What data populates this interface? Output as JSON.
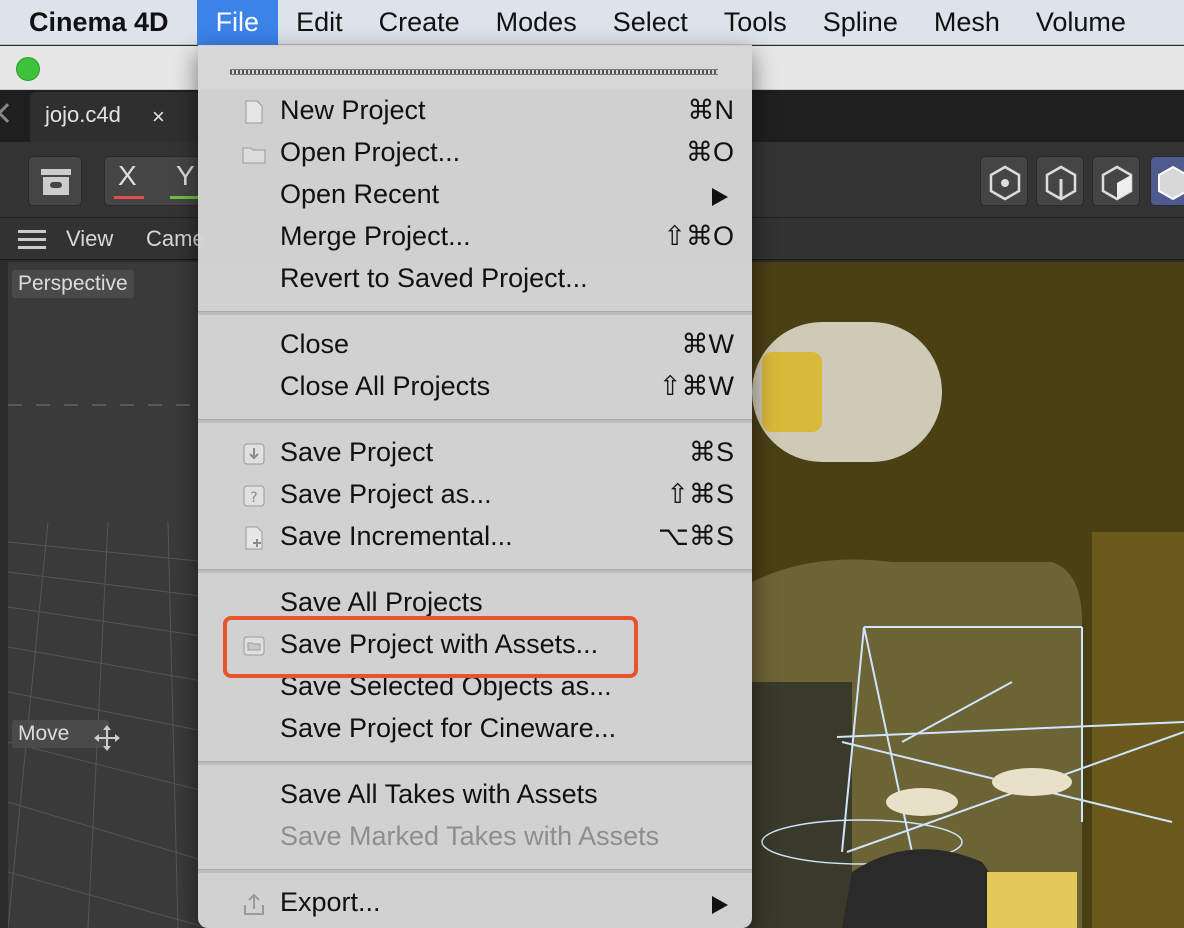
{
  "menubar": {
    "app_name": "Cinema 4D",
    "items": [
      "File",
      "Edit",
      "Create",
      "Modes",
      "Select",
      "Tools",
      "Spline",
      "Mesh",
      "Volume"
    ]
  },
  "tab": {
    "title": "jojo.c4d",
    "close": "×"
  },
  "toolbar": {
    "axis_x": "X",
    "axis_y": "Y",
    "axis_x_color": "#e05050",
    "axis_y_color": "#6cc04a"
  },
  "viewport": {
    "menu_view": "View",
    "menu_camera": "Came",
    "perspective": "Perspective",
    "move": "Move",
    "move_icon": "move-arrows-icon"
  },
  "file_menu": {
    "items": [
      {
        "label": "New Project",
        "shortcut": "⌘N",
        "icon": "document-icon"
      },
      {
        "label": "Open Project...",
        "shortcut": "⌘O",
        "icon": "folder-icon"
      },
      {
        "label": "Open Recent",
        "shortcut": "",
        "submenu": true
      },
      {
        "label": "Merge Project...",
        "shortcut": "⇧⌘O"
      },
      {
        "label": "Revert to Saved Project...",
        "shortcut": ""
      },
      {
        "label": "Close",
        "shortcut": "⌘W"
      },
      {
        "label": "Close All Projects",
        "shortcut": "⇧⌘W"
      },
      {
        "label": "Save Project",
        "shortcut": "⌘S",
        "icon": "save-icon"
      },
      {
        "label": "Save Project as...",
        "shortcut": "⇧⌘S",
        "icon": "save-as-icon"
      },
      {
        "label": "Save Incremental...",
        "shortcut": "⌥⌘S",
        "icon": "save-incremental-icon"
      },
      {
        "label": "Save All Projects",
        "shortcut": ""
      },
      {
        "label": "Save Project with Assets...",
        "shortcut": "",
        "icon": "folder-icon",
        "highlighted": true
      },
      {
        "label": "Save Selected Objects as...",
        "shortcut": ""
      },
      {
        "label": "Save Project for Cineware...",
        "shortcut": ""
      },
      {
        "label": "Save All Takes with Assets",
        "shortcut": ""
      },
      {
        "label": "Save Marked Takes with Assets",
        "shortcut": "",
        "disabled": true
      },
      {
        "label": "Export...",
        "shortcut": "",
        "submenu": true,
        "icon": "export-icon"
      }
    ]
  },
  "colors": {
    "highlight_border": "#e8532a",
    "menu_active": "#3b82e9"
  }
}
